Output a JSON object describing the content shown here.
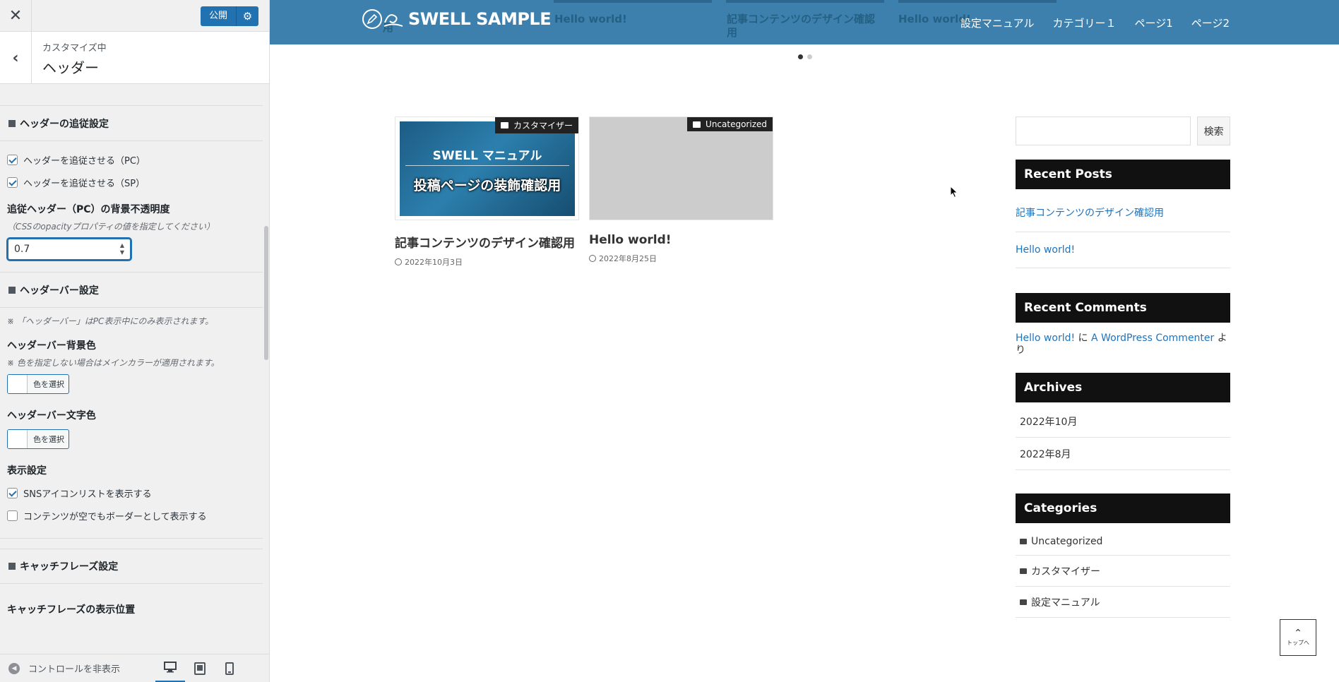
{
  "customizer": {
    "publish_label": "公開",
    "section_subtitle": "カスタマイズ中",
    "section_title": "ヘッダー",
    "groups": [
      {
        "title": "ヘッダーの追従設定",
        "checkboxes": [
          {
            "label": "ヘッダーを追従させる（PC）",
            "checked": true
          },
          {
            "label": "ヘッダーを追従させる（SP）",
            "checked": true
          }
        ],
        "opacity_label": "追従ヘッダー（PC）の背景不透明度",
        "opacity_desc": "（CSSのopacityプロパティの値を指定してください）",
        "opacity_value": "0.7"
      },
      {
        "title": "ヘッダーバー設定",
        "note": "「ヘッダーバー」はPC表示中にのみ表示されます。",
        "bg_label": "ヘッダーバー背景色",
        "bg_note": "色を指定しない場合はメインカラーが適用されます。",
        "text_label": "ヘッダーバー文字色",
        "color_button": "色を選択",
        "display_label": "表示設定",
        "display_checkboxes": [
          {
            "label": "SNSアイコンリストを表示する",
            "checked": true
          },
          {
            "label": "コンテンツが空でもボーダーとして表示する",
            "checked": false
          }
        ]
      },
      {
        "title": "キャッチフレーズ設定",
        "first_label": "キャッチフレーズの表示位置"
      }
    ],
    "footer": {
      "hide_controls": "コントロールを非表示"
    }
  },
  "site": {
    "logo": "SWELL SAMPLE",
    "nav": [
      "設定マニュアル",
      "カテゴリー１",
      "ページ1",
      "ページ2"
    ],
    "slider_ghosts": [
      "用",
      "Hello world!",
      "記事コンテンツのデザイン確認",
      "用",
      "Hello world!"
    ],
    "posts": [
      {
        "category": "カスタマイザー",
        "title": "記事コンテンツのデザイン確認用",
        "date": "2022年10月3日",
        "thumb_line1": "SWELL マニュアル",
        "thumb_line2": "投稿ページの装飾確認用"
      },
      {
        "category": "Uncategorized",
        "title": "Hello world!",
        "date": "2022年8月25日"
      }
    ],
    "search_button": "検索",
    "recent_posts": {
      "title": "Recent Posts",
      "items": [
        "記事コンテンツのデザイン確認用",
        "Hello world!"
      ]
    },
    "recent_comments": {
      "title": "Recent Comments",
      "post_link": "Hello world!",
      "connector": " に ",
      "author_link": "A WordPress Commenter",
      "suffix": " より"
    },
    "archives": {
      "title": "Archives",
      "items": [
        "2022年10月",
        "2022年8月"
      ]
    },
    "categories": {
      "title": "Categories",
      "items": [
        "Uncategorized",
        "カスタマイザー",
        "設定マニュアル"
      ]
    },
    "to_top": "トップへ"
  },
  "colors": {
    "header_bg": "#3e80ad",
    "wp_blue": "#2271b1",
    "link_blue": "#1e73be",
    "widget_head": "#111111"
  }
}
